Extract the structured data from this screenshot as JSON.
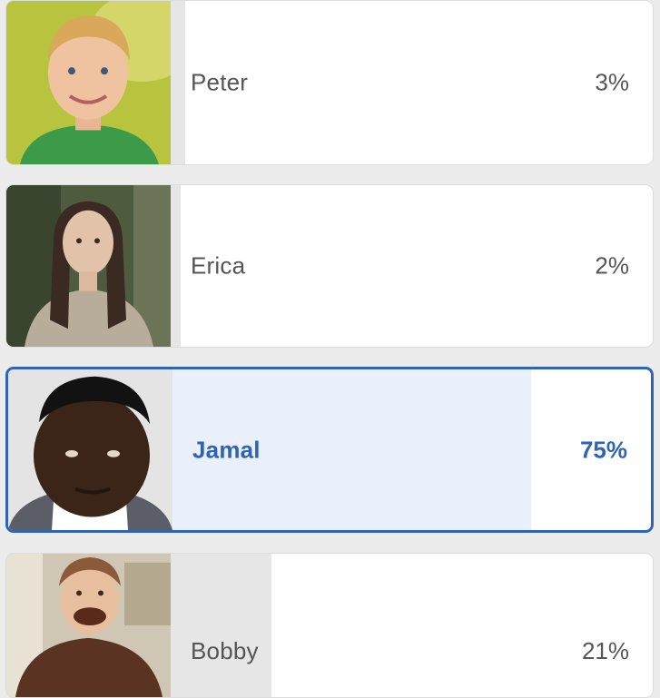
{
  "poll": {
    "options": [
      {
        "name": "Peter",
        "percent_text": "3%",
        "percent": 3,
        "selected": false,
        "photo_icon": "avatar-photo-peter"
      },
      {
        "name": "Erica",
        "percent_text": "2%",
        "percent": 2,
        "selected": false,
        "photo_icon": "avatar-photo-erica"
      },
      {
        "name": "Jamal",
        "percent_text": "75%",
        "percent": 75,
        "selected": true,
        "photo_icon": "avatar-photo-jamal"
      },
      {
        "name": "Bobby",
        "percent_text": "21%",
        "percent": 21,
        "selected": false,
        "photo_icon": "avatar-photo-bobby"
      }
    ]
  },
  "colors": {
    "accent": "#2f64b4",
    "selected_fill": "#e9f0fb",
    "result_fill": "#e6e6e6",
    "text": "#555555"
  }
}
